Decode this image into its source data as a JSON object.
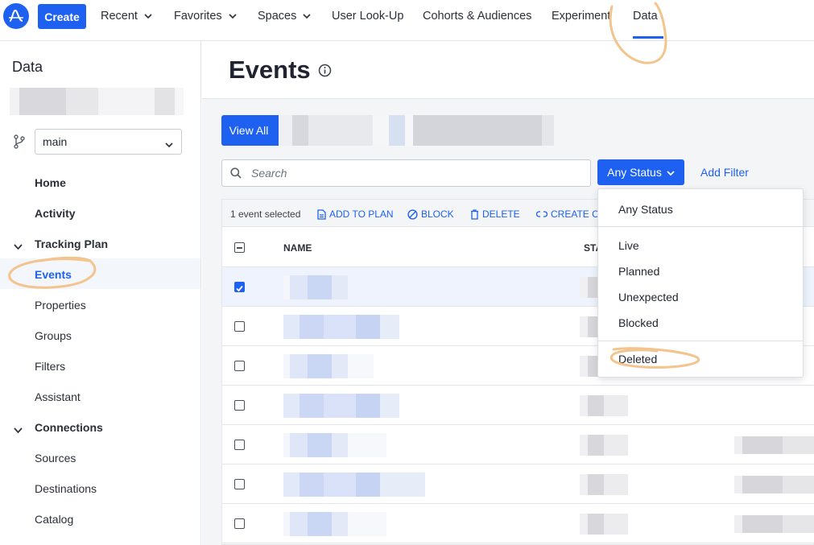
{
  "topnav": {
    "create_label": "Create",
    "items": [
      {
        "label": "Recent",
        "has_chevron": true
      },
      {
        "label": "Favorites",
        "has_chevron": true
      },
      {
        "label": "Spaces",
        "has_chevron": true
      },
      {
        "label": "User Look-Up",
        "has_chevron": false
      },
      {
        "label": "Cohorts & Audiences",
        "has_chevron": false
      },
      {
        "label": "Experiment",
        "has_chevron": false
      },
      {
        "label": "Data",
        "has_chevron": false,
        "active": true
      }
    ]
  },
  "sidebar": {
    "title": "Data",
    "branch": {
      "value": "main"
    },
    "items": [
      {
        "label": "Home",
        "style": "bold"
      },
      {
        "label": "Activity",
        "style": "bold"
      },
      {
        "label": "Tracking Plan",
        "style": "bold",
        "section": true,
        "expanded": true
      },
      {
        "label": "Events",
        "style": "active"
      },
      {
        "label": "Properties",
        "style": "normal"
      },
      {
        "label": "Groups",
        "style": "normal"
      },
      {
        "label": "Filters",
        "style": "normal"
      },
      {
        "label": "Assistant",
        "style": "normal"
      },
      {
        "label": "Connections",
        "style": "bold",
        "section": true,
        "expanded": true
      },
      {
        "label": "Sources",
        "style": "normal"
      },
      {
        "label": "Destinations",
        "style": "normal"
      },
      {
        "label": "Catalog",
        "style": "normal"
      }
    ]
  },
  "main": {
    "title": "Events",
    "view_all_label": "View All",
    "search": {
      "placeholder": "Search",
      "value": ""
    },
    "status_button": "Any Status",
    "add_filter": "Add Filter",
    "toolbar": {
      "selected_text": "1 event selected",
      "actions": [
        {
          "label": "ADD TO PLAN",
          "icon": "document-icon"
        },
        {
          "label": "BLOCK",
          "icon": "block-icon"
        },
        {
          "label": "DELETE",
          "icon": "trash-icon"
        },
        {
          "label": "CREATE CU",
          "icon": "link-icon"
        }
      ]
    },
    "table": {
      "columns": [
        "NAME",
        "STA"
      ],
      "rows": [
        {
          "checked": true
        },
        {
          "checked": false
        },
        {
          "checked": false
        },
        {
          "checked": false
        },
        {
          "checked": false
        },
        {
          "checked": false
        },
        {
          "checked": false
        }
      ]
    }
  },
  "status_dropdown": {
    "options": [
      "Any Status",
      "Live",
      "Planned",
      "Unexpected",
      "Blocked",
      "Deleted"
    ]
  },
  "colors": {
    "accent": "#1e61f0",
    "annotation": "#f3c48d"
  }
}
